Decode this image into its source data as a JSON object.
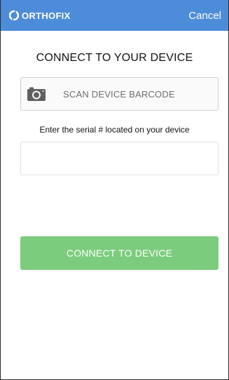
{
  "navbar": {
    "logo_text": "ORTHOFIX",
    "cancel_label": "Cancel",
    "background": "#4d8cd9"
  },
  "main": {
    "title": "CONNECT TO YOUR DEVICE",
    "scan_button": {
      "icon": "camera-icon",
      "label": "SCAN DEVICE BARCODE"
    },
    "serial_label": "Enter the serial # located on your device",
    "serial_input": {
      "value": "",
      "placeholder": ""
    },
    "connect_button": {
      "label": "CONNECT TO DEVICE",
      "color": "#7ccc7e"
    }
  }
}
